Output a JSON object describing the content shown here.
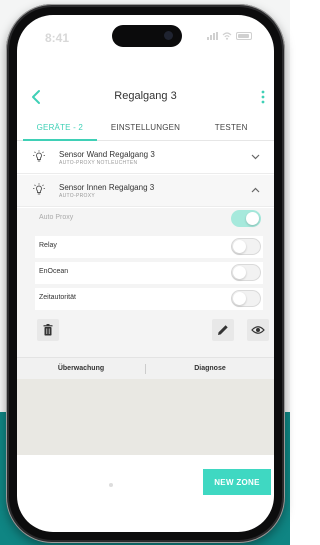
{
  "status": {
    "time": "8:41"
  },
  "header": {
    "title": "Regalgang 3"
  },
  "tabs": [
    {
      "label": "GERÄTE - 2",
      "active": true
    },
    {
      "label": "EINSTELLUNGEN",
      "active": false
    },
    {
      "label": "TESTEN",
      "active": false
    }
  ],
  "sensors": [
    {
      "name": "Sensor Wand Regalgang 3",
      "subtitle": "AUTO-PROXY  NOTLEUCHTEN",
      "expanded": false
    },
    {
      "name": "Sensor Innen Regalgang 3",
      "subtitle": "AUTO-PROXY",
      "expanded": true
    }
  ],
  "settings": [
    {
      "label": "Auto Proxy",
      "on": true,
      "disabled": true
    },
    {
      "label": "Relay",
      "on": false
    },
    {
      "label": "EnOcean",
      "on": false
    },
    {
      "label": "Zeitautorität",
      "on": false
    }
  ],
  "subtabs": {
    "left": "Überwachung",
    "right": "Diagnose"
  },
  "actions": {
    "new_zone": "NEW ZONE"
  },
  "colors": {
    "accent": "#3fd0b6",
    "teal_background": "#0f8583"
  },
  "icons": [
    "back-arrow-icon",
    "more-vertical-icon",
    "lightbulb-icon",
    "chevron-down-icon",
    "chevron-up-icon",
    "trash-icon",
    "pencil-icon",
    "eye-icon"
  ]
}
